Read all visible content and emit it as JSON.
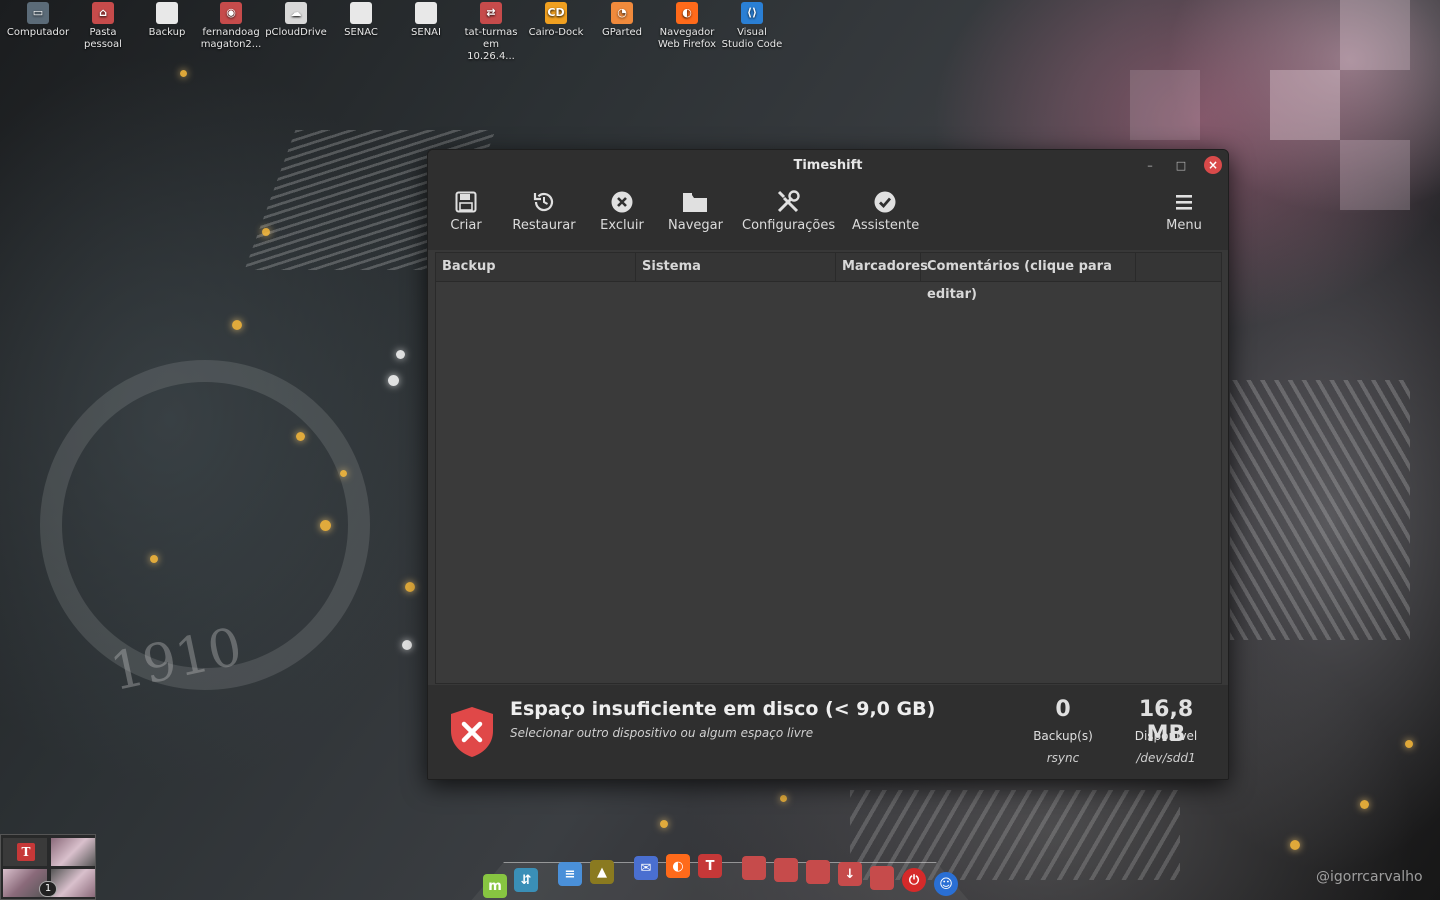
{
  "desktop_icons": [
    {
      "label": "Computador",
      "icon": "computer-icon",
      "color": "#5b6b78"
    },
    {
      "label": "Pasta pessoal",
      "icon": "home-folder-icon",
      "color": "#c64b4b"
    },
    {
      "label": "Backup",
      "icon": "file-icon",
      "color": "#e8e8e8"
    },
    {
      "label": "fernandoag magaton2...",
      "icon": "drive-folder-icon",
      "color": "#c64b4b"
    },
    {
      "label": "pCloudDrive",
      "icon": "cloud-drive-icon",
      "color": "#d8d8d8"
    },
    {
      "label": "SENAC",
      "icon": "file-icon",
      "color": "#e8e8e8"
    },
    {
      "label": "SENAI",
      "icon": "file-icon",
      "color": "#e8e8e8"
    },
    {
      "label": "tat-turmas em 10.26.4...",
      "icon": "network-folder-icon",
      "color": "#c64b4b"
    },
    {
      "label": "Cairo-Dock",
      "icon": "cairo-dock-icon",
      "color": "#f0a020"
    },
    {
      "label": "GParted",
      "icon": "gparted-icon",
      "color": "#f08a3c"
    },
    {
      "label": "Navegador Web Firefox",
      "icon": "firefox-icon",
      "color": "#ff6a1a"
    },
    {
      "label": "Visual Studio Code",
      "icon": "vscode-icon",
      "color": "#2a7fd4"
    }
  ],
  "window": {
    "title": "Timeshift",
    "controls": {
      "minimize": "–",
      "maximize": "□",
      "close": "×"
    }
  },
  "toolbar": {
    "criar": "Criar",
    "restaurar": "Restaurar",
    "excluir": "Excluir",
    "navegar": "Navegar",
    "configuracoes": "Configurações",
    "assistente": "Assistente",
    "menu": "Menu"
  },
  "table": {
    "columns": [
      "Backup",
      "Sistema",
      "Marcadores",
      "Comentários (clique para editar)"
    ],
    "rows": []
  },
  "status": {
    "title": "Espaço insuficiente em disco (< 9,0 GB)",
    "subtitle": "Selecionar outro dispositivo ou algum espaço livre",
    "backups_count": "0",
    "backups_label": "Backup(s)",
    "backups_mode": "rsync",
    "available_value": "16,8 MB",
    "available_label": "Disponível",
    "available_device": "/dev/sdd1",
    "error_color": "#e04848"
  },
  "workspace": {
    "badge": "1"
  },
  "dock": [
    {
      "icon": "linux-mint-icon",
      "color": "#87c541"
    },
    {
      "icon": "file-manager-icon",
      "color": "#3a8fb7"
    },
    {
      "icon": "text-editor-icon",
      "color": "#4a90d9"
    },
    {
      "icon": "image-viewer-icon",
      "color": "#8a7a20"
    },
    {
      "icon": "mail-icon",
      "color": "#4a6fd0"
    },
    {
      "icon": "firefox-icon",
      "color": "#ff6a1a"
    },
    {
      "icon": "font-manager-icon",
      "color": "#c63838"
    },
    {
      "icon": "folder-icon",
      "color": "#c64b4b"
    },
    {
      "icon": "folder-icon",
      "color": "#c64b4b"
    },
    {
      "icon": "folder-icon",
      "color": "#c64b4b"
    },
    {
      "icon": "download-folder-icon",
      "color": "#c64b4b"
    },
    {
      "icon": "folder-icon",
      "color": "#c64b4b"
    },
    {
      "icon": "power-icon",
      "color": "#d62a2a"
    },
    {
      "icon": "accessibility-icon",
      "color": "#2a6fd4"
    }
  ],
  "watermark": "@igorrcarvalho"
}
